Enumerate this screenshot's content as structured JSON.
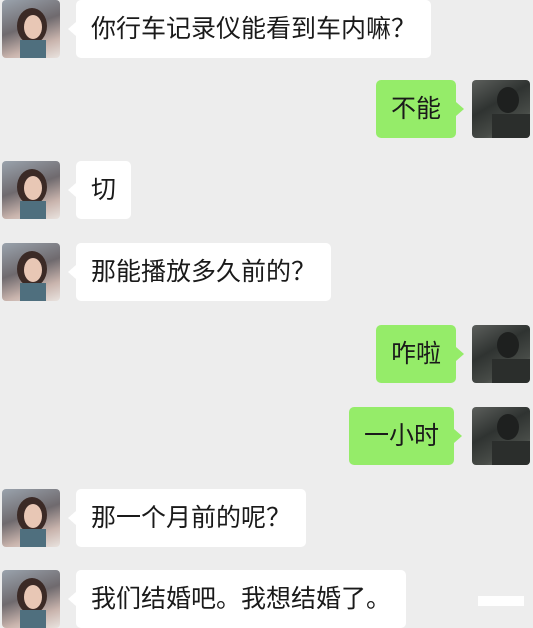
{
  "messages": [
    {
      "sender": "her",
      "text": "你行车记录仪能看到车内嘛？"
    },
    {
      "sender": "me",
      "text": "不能"
    },
    {
      "sender": "her",
      "text": "切"
    },
    {
      "sender": "her",
      "text": "那能播放多久前的？"
    },
    {
      "sender": "me",
      "text": "咋啦"
    },
    {
      "sender": "me",
      "text": "一小时"
    },
    {
      "sender": "her",
      "text": "那一个月前的呢？"
    },
    {
      "sender": "her",
      "text": "我们结婚吧。我想结婚了。"
    }
  ],
  "colors": {
    "background": "#ededed",
    "incoming_bubble": "#ffffff",
    "outgoing_bubble": "#95ec69",
    "text": "#1a1a1a"
  }
}
